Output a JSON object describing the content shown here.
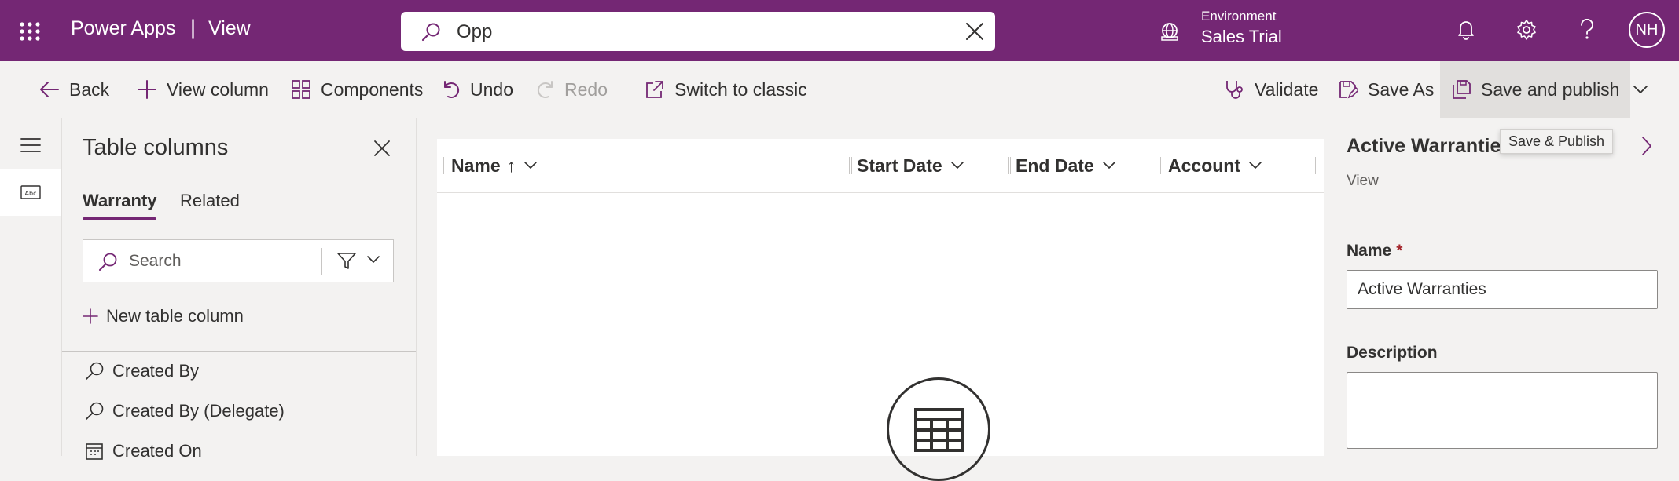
{
  "header": {
    "app_name": "Power Apps",
    "separator": "|",
    "page_name": "View",
    "search": {
      "value": "Opp"
    },
    "environment": {
      "label": "Environment",
      "name": "Sales Trial"
    },
    "user_initials": "NH",
    "icons": [
      "waffle-icon",
      "search-icon",
      "close-icon",
      "environment-icon",
      "bell-icon",
      "gear-icon",
      "help-icon"
    ]
  },
  "commands": {
    "back": "Back",
    "view_column": "View column",
    "components": "Components",
    "undo": "Undo",
    "redo": "Redo",
    "switch_classic": "Switch to classic",
    "validate": "Validate",
    "save_as": "Save As",
    "save_publish": "Save and publish"
  },
  "panel": {
    "title": "Table columns",
    "tabs": [
      {
        "label": "Warranty",
        "active": true
      },
      {
        "label": "Related",
        "active": false
      }
    ],
    "search_placeholder": "Search",
    "new_column": "New table column",
    "fields": [
      {
        "label": "Created By",
        "icon": "lookup-icon"
      },
      {
        "label": "Created By (Delegate)",
        "icon": "lookup-icon"
      },
      {
        "label": "Created On",
        "icon": "calendar-icon"
      }
    ]
  },
  "grid": {
    "columns": [
      {
        "label": "Name",
        "sort": "↑"
      },
      {
        "label": "Start Date"
      },
      {
        "label": "End Date"
      },
      {
        "label": "Account"
      }
    ]
  },
  "props": {
    "title": "Active Warranties",
    "subtitle": "View",
    "tooltip": "Save & Publish",
    "name_label": "Name",
    "required_mark": "*",
    "name_value": "Active Warranties",
    "description_label": "Description",
    "description_value": ""
  },
  "colors": {
    "brand": "#742774",
    "background": "#f3f2f1",
    "text": "#323130",
    "required": "#a4262c"
  }
}
